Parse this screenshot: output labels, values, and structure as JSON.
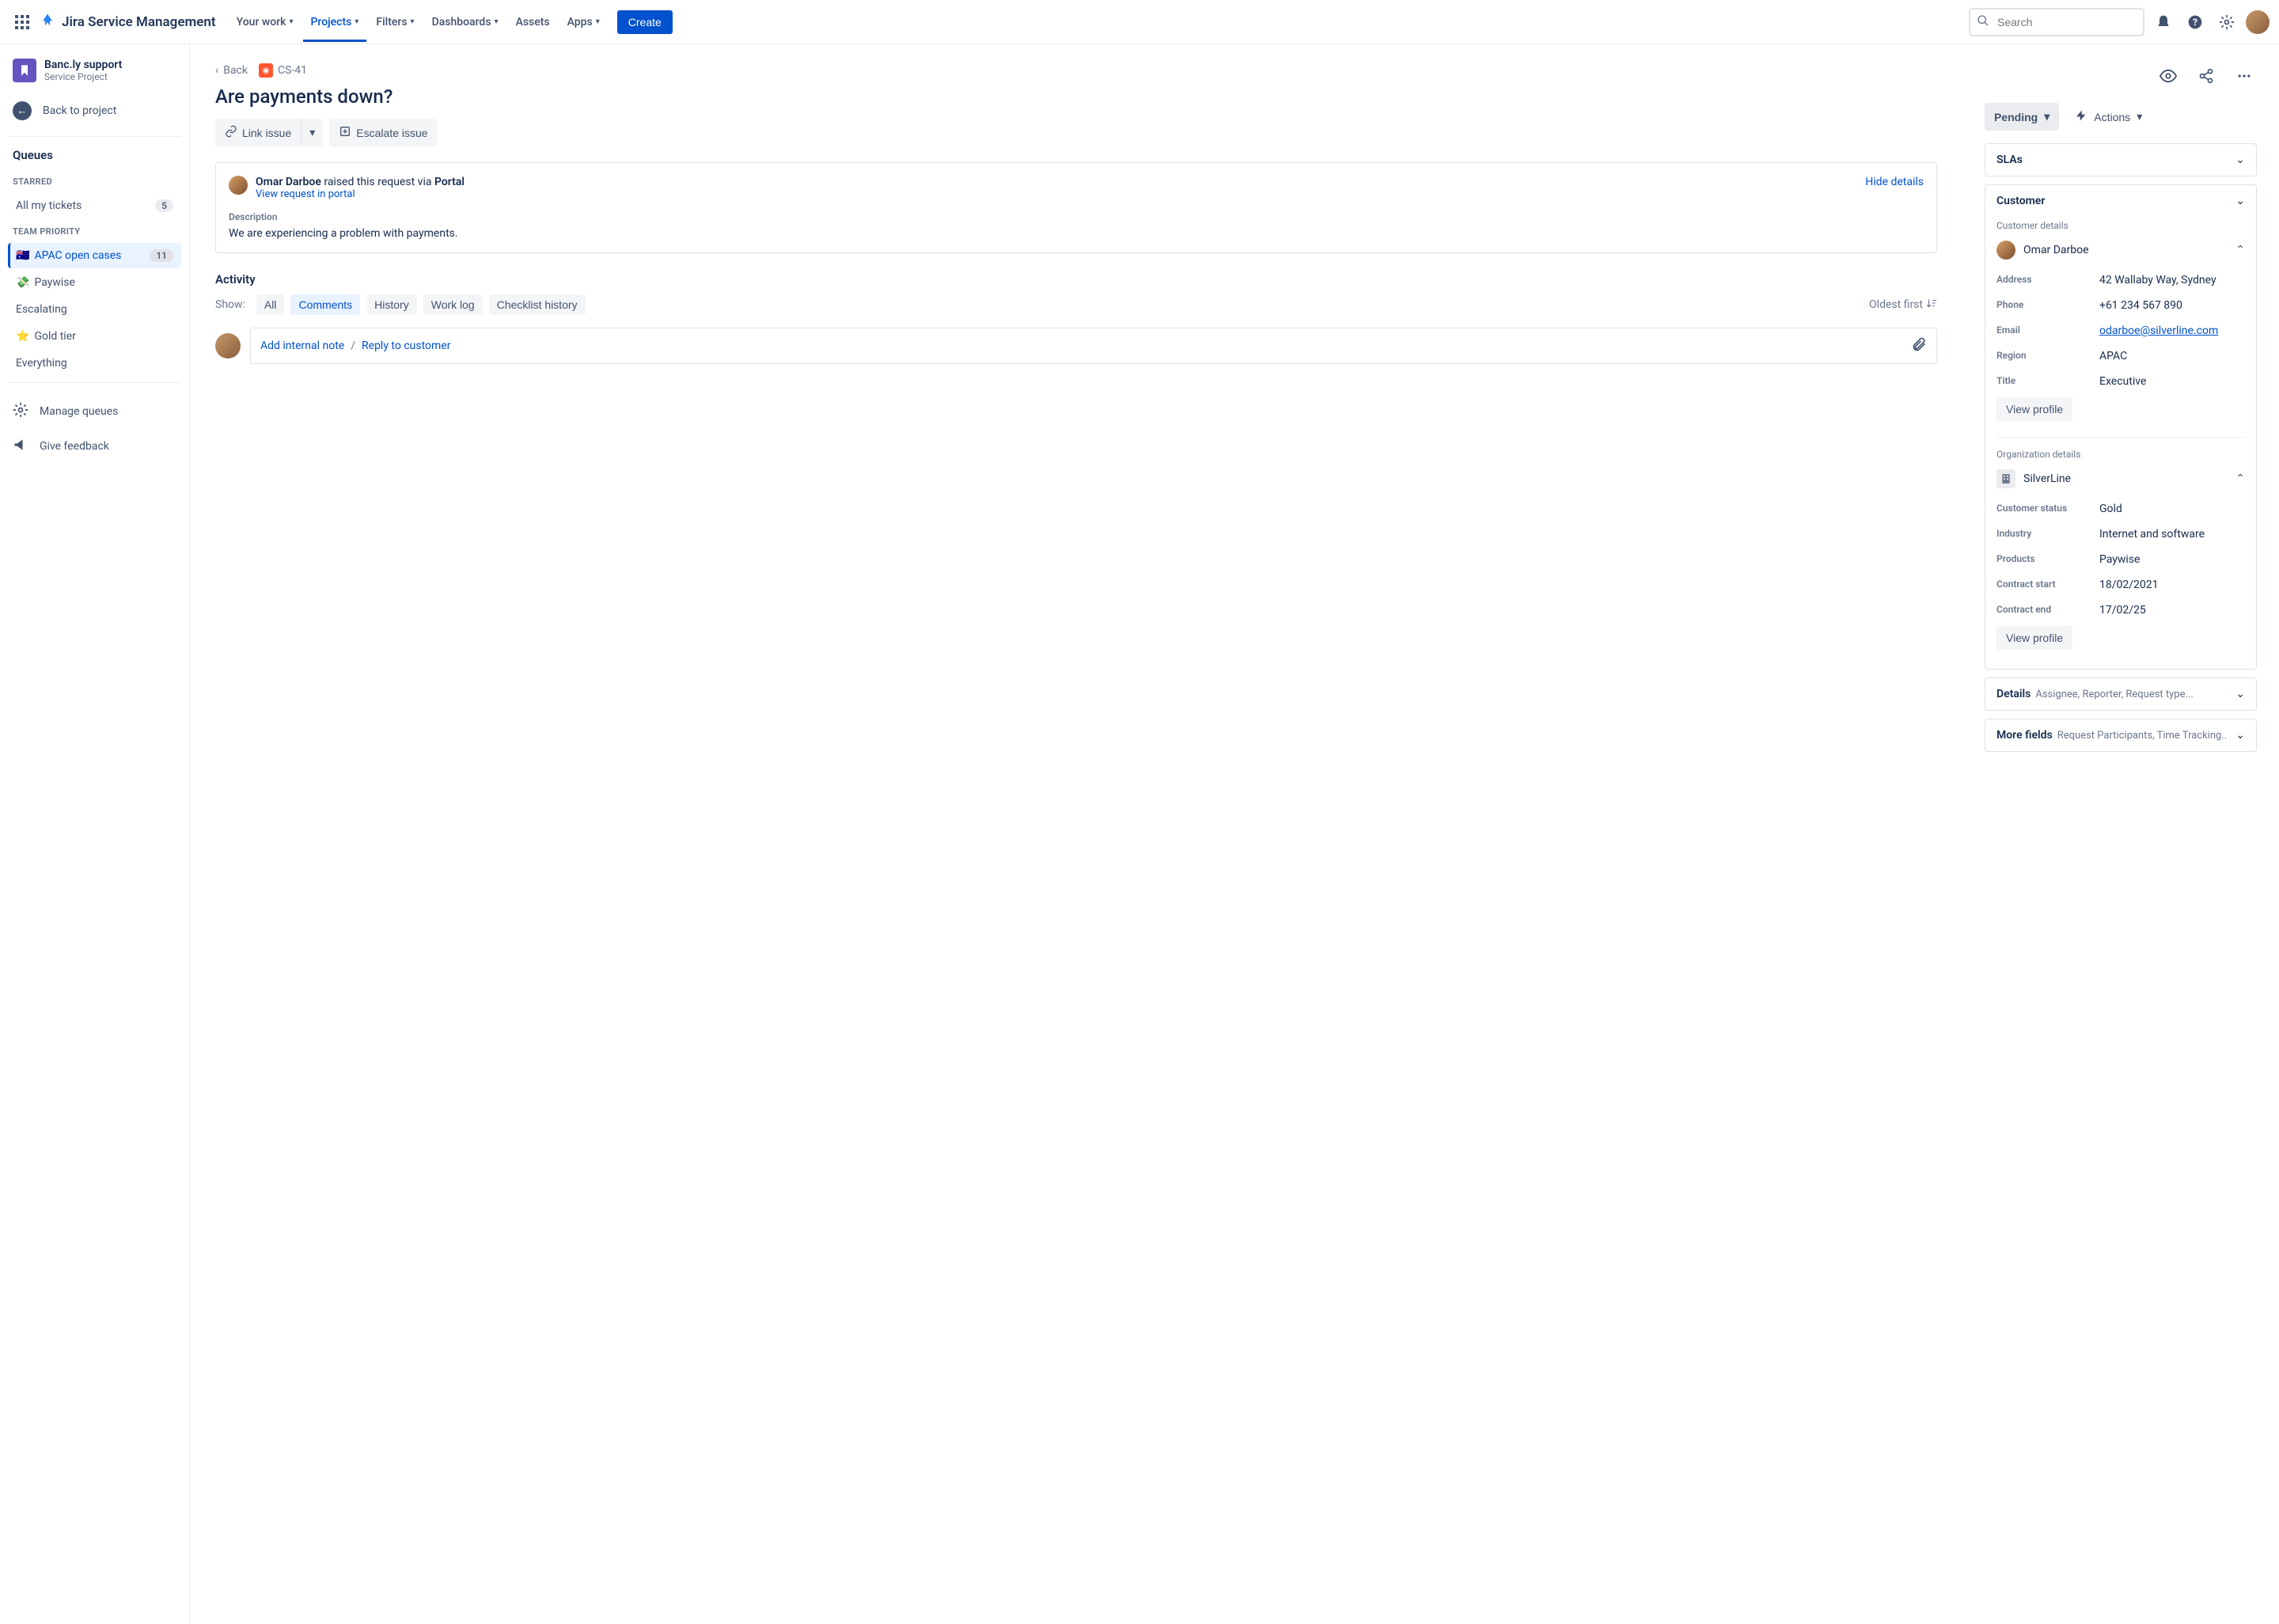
{
  "topnav": {
    "product": "Jira Service Management",
    "items": [
      "Your work",
      "Projects",
      "Filters",
      "Dashboards",
      "Assets",
      "Apps"
    ],
    "create": "Create",
    "search_placeholder": "Search"
  },
  "sidebar": {
    "project_name": "Banc.ly support",
    "project_sub": "Service Project",
    "back_to_project": "Back to project",
    "section": "Queues",
    "starred_label": "Starred",
    "starred_items": [
      {
        "label": "All my tickets",
        "count": "5"
      }
    ],
    "team_label": "Team Priority",
    "team_items": [
      {
        "flag": "🇦🇺",
        "label": "APAC open cases",
        "count": "11",
        "selected": true
      },
      {
        "flag": "💸",
        "label": "Paywise"
      },
      {
        "label": "Escalating"
      },
      {
        "flag": "⭐",
        "label": "Gold tier"
      },
      {
        "label": "Everything"
      }
    ],
    "manage_queues": "Manage queues",
    "give_feedback": "Give feedback"
  },
  "issue": {
    "back": "Back",
    "key": "CS-41",
    "title": "Are payments down?",
    "link_issue": "Link issue",
    "escalate": "Escalate issue",
    "requester": "Omar Darboe",
    "raised_via": "raised this request via",
    "portal": "Portal",
    "view_portal": "View request in portal",
    "hide_details": "Hide details",
    "desc_label": "Description",
    "desc_text": "We are experiencing a problem with payments.",
    "activity": "Activity",
    "show": "Show:",
    "tabs": [
      "All",
      "Comments",
      "History",
      "Work log",
      "Checklist history"
    ],
    "sort": "Oldest first",
    "add_note": "Add internal note",
    "reply": "Reply to customer"
  },
  "right": {
    "status": "Pending",
    "actions": "Actions",
    "slas": "SLAs",
    "customer_section": "Customer",
    "customer_details": "Customer details",
    "customer_name": "Omar Darboe",
    "fields": [
      {
        "label": "Address",
        "value": "42 Wallaby Way, Sydney"
      },
      {
        "label": "Phone",
        "value": "+61 234 567 890"
      },
      {
        "label": "Email",
        "value": "odarboe@silverline.com",
        "link": true
      },
      {
        "label": "Region",
        "value": "APAC"
      },
      {
        "label": "Title",
        "value": "Executive"
      }
    ],
    "org_details": "Organization details",
    "org_name": "SilverLine",
    "org_fields": [
      {
        "label": "Customer status",
        "value": "Gold"
      },
      {
        "label": "Industry",
        "value": "Internet and software"
      },
      {
        "label": "Products",
        "value": "Paywise"
      },
      {
        "label": "Contract start",
        "value": "18/02/2021"
      },
      {
        "label": "Contract end",
        "value": "17/02/25"
      }
    ],
    "view_profile": "View profile",
    "details": "Details",
    "details_sub": "Assignee, Reporter, Request type...",
    "more_fields": "More fields",
    "more_fields_sub": "Request Participants, Time Tracking.."
  }
}
